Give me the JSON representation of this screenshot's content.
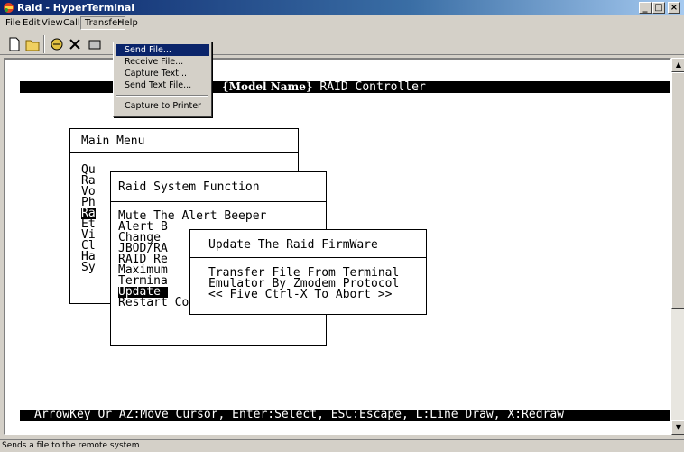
{
  "window": {
    "title": "Raid - HyperTerminal",
    "minimize": "_",
    "maximize": "□",
    "close": "×"
  },
  "menubar": {
    "items": [
      "File",
      "Edit",
      "View",
      "Call",
      "Transfer",
      "Help"
    ]
  },
  "transfer_menu": {
    "items": [
      "Send File...",
      "Receive File...",
      "Capture Text...",
      "Send Text File...",
      "Capture to Printer"
    ],
    "selected": "Send File..."
  },
  "toolbar": {
    "icons": [
      "new-connection-icon",
      "open-icon",
      "call-icon",
      "disconnect-icon",
      "send-icon",
      "receive-icon",
      "properties-icon"
    ]
  },
  "terminal": {
    "header_model": "{Model Name}",
    "header_rest": " RAID Controller",
    "main_menu": {
      "title": "Main Menu",
      "items": [
        "Qu",
        "Ra",
        "Vo",
        "Ph",
        "Ra",
        "Et",
        "Vi",
        "Cl",
        "Ha",
        "Sy"
      ]
    },
    "raid_system_function": {
      "title": "Raid System Function",
      "items": [
        "Mute The Alert Beeper",
        "Alert B",
        "Change",
        "JBOD/RA",
        "RAID Re",
        "Maximum",
        "Termina",
        "Update ",
        "Restart Controller"
      ]
    },
    "update_firmware": {
      "title": "Update The Raid FirmWare",
      "lines": [
        "Transfer File From Terminal",
        "Emulator By Zmodem Protocol",
        "<< Five Ctrl-X To Abort >>"
      ]
    },
    "footer": "ArrowKey Or AZ:Move Cursor, Enter:Select, ESC:Escape, L:Line Draw, X:Redraw"
  },
  "statusbar": {
    "text": "Sends a file to the remote system"
  }
}
